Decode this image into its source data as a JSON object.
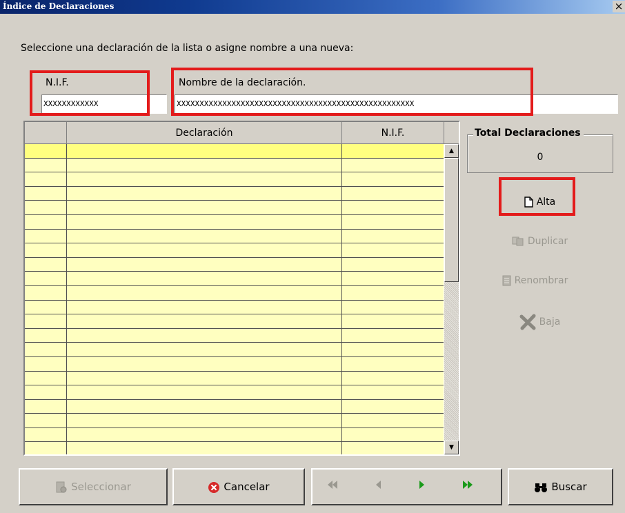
{
  "window": {
    "title": "Índice de Declaraciones",
    "close_glyph": "×"
  },
  "prompt": "Seleccione una declaración de la lista o asigne nombre a una nueva:",
  "nif": {
    "label": "N.I.F.",
    "value": "XXXXXXXXXXXX"
  },
  "nombre": {
    "label": "Nombre de la declaración.",
    "value": "XXXXXXXXXXXXXXXXXXXXXXXXXXXXXXXXXXXXXXXXXXXXXXXXXXXX"
  },
  "table": {
    "columns": [
      "",
      "Declaración",
      "N.I.F."
    ],
    "rows": []
  },
  "total": {
    "title": "Total Declaraciones",
    "value": "0"
  },
  "side_buttons": {
    "alta": "Alta",
    "duplicar": "Duplicar",
    "renombrar": "Renombrar",
    "baja": "Baja"
  },
  "bottom_buttons": {
    "seleccionar": "Seleccionar",
    "cancelar": "Cancelar",
    "buscar": "Buscar"
  },
  "icons": [
    "new-document-icon",
    "copy-icon",
    "rename-icon",
    "delete-x-icon",
    "select-icon",
    "cancel-icon",
    "first-icon",
    "prev-icon",
    "next-icon",
    "last-icon",
    "binoculars-icon"
  ],
  "colors": {
    "highlight": "#e31b1b",
    "row_bg": "#ffffc0",
    "selected_row_bg": "#ffff80",
    "title_bg": "#0a246a"
  }
}
